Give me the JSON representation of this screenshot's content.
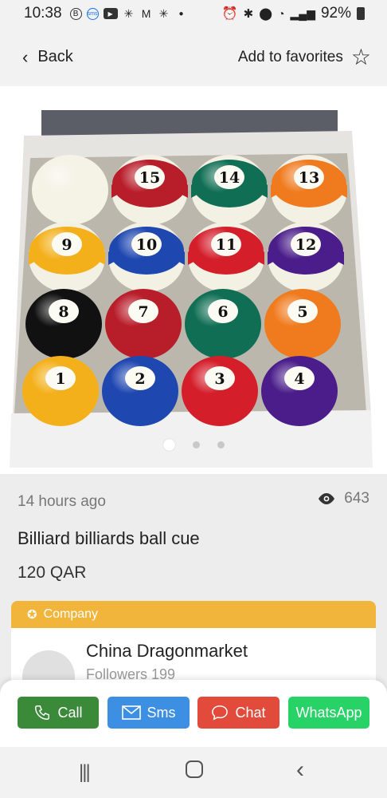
{
  "status_bar": {
    "time": "10:38",
    "icons_left": [
      "b-circle-icon",
      "messages-icon",
      "youtube-icon",
      "flower-icon",
      "gmail-icon",
      "flower-icon",
      "dot-icon"
    ],
    "icons_right": [
      "alarm-icon",
      "bluetooth-icon",
      "location-icon",
      "wifi-icon",
      "signal-icon"
    ],
    "battery": "92%"
  },
  "header": {
    "back_label": "Back",
    "favorite_label": "Add to favorites"
  },
  "gallery": {
    "image_alt": "billiard balls in box",
    "pages": 3,
    "current_page": 1,
    "balls": [
      {
        "n": "",
        "color": "#f5f2e6",
        "stripe": false,
        "cue": true
      },
      {
        "n": "15",
        "color": "#b81d2a",
        "stripe": true
      },
      {
        "n": "14",
        "color": "#0f6e54",
        "stripe": true
      },
      {
        "n": "13",
        "color": "#f07a1e",
        "stripe": true
      },
      {
        "n": "9",
        "color": "#f4b01b",
        "stripe": true
      },
      {
        "n": "10",
        "color": "#1f47b0",
        "stripe": true
      },
      {
        "n": "11",
        "color": "#d41f2b",
        "stripe": true
      },
      {
        "n": "12",
        "color": "#4a1d8a",
        "stripe": true
      },
      {
        "n": "8",
        "color": "#111111",
        "stripe": false
      },
      {
        "n": "7",
        "color": "#b81d2a",
        "stripe": false
      },
      {
        "n": "6",
        "color": "#0f6e54",
        "stripe": false
      },
      {
        "n": "5",
        "color": "#f07a1e",
        "stripe": false
      },
      {
        "n": "1",
        "color": "#f4b01b",
        "stripe": false
      },
      {
        "n": "2",
        "color": "#1f47b0",
        "stripe": false
      },
      {
        "n": "3",
        "color": "#d41f2b",
        "stripe": false
      },
      {
        "n": "4",
        "color": "#4a1d8a",
        "stripe": false
      }
    ]
  },
  "listing": {
    "time_ago": "14 hours ago",
    "views": "643",
    "title": "Billiard billiards ball cue",
    "price": "120 QAR"
  },
  "company": {
    "header_label": "Company",
    "name": "China Dragonmarket",
    "followers": "Followers   199"
  },
  "actions": {
    "call": "Call",
    "sms": "Sms",
    "chat": "Chat",
    "whatsapp": "WhatsApp"
  },
  "colors": {
    "call": "#3b8a3a",
    "sms": "#3c8fe3",
    "chat": "#e24b3b",
    "whatsapp": "#27d366",
    "company_header": "#f0b53a"
  }
}
